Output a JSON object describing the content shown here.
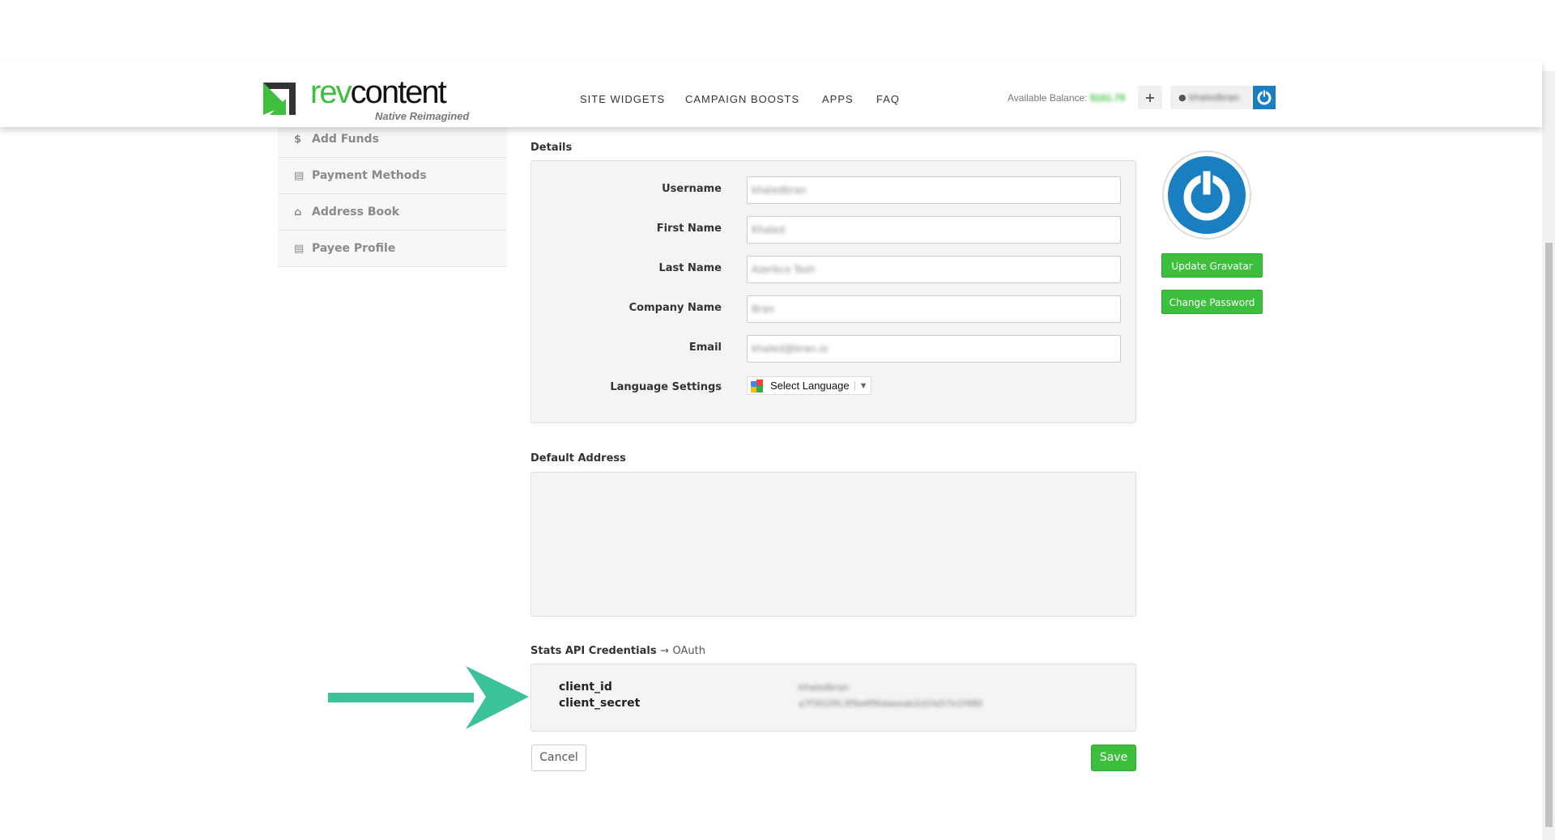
{
  "header": {
    "logo_text_a": "rev",
    "logo_text_b": "content",
    "logo_tagline": "Native Reimagined",
    "nav": [
      "SITE WIDGETS",
      "CAMPAIGN BOOSTS",
      "APPS",
      "FAQ"
    ],
    "balance_label": "Available Balance:",
    "balance_value": "$161.79",
    "add_funds_symbol": "+",
    "username": "khaledbran"
  },
  "sidebar": {
    "items": [
      {
        "icon": "dollar-icon",
        "label": "Add Funds"
      },
      {
        "icon": "credit-card-icon",
        "label": "Payment Methods"
      },
      {
        "icon": "home-icon",
        "label": "Address Book"
      },
      {
        "icon": "document-icon",
        "label": "Payee Profile"
      }
    ]
  },
  "details": {
    "title": "Details",
    "fields": [
      {
        "label": "Username",
        "value": "khaledbran"
      },
      {
        "label": "First Name",
        "value": "Khaled"
      },
      {
        "label": "Last Name",
        "value": "Azerbco Tosh"
      },
      {
        "label": "Company Name",
        "value": "Bran"
      },
      {
        "label": "Email",
        "value": "khaled@bran.io"
      }
    ],
    "language_label": "Language Settings",
    "language_select": "Select Language"
  },
  "profile": {
    "update_gravatar": "Update Gravatar",
    "change_password": "Change Password"
  },
  "address": {
    "title": "Default Address"
  },
  "credentials": {
    "title": "Stats API Credentials",
    "arrow": "→",
    "subtitle": "OAuth",
    "client_id_label": "client_id",
    "client_id_value": "khaledbran",
    "client_secret_label": "client_secret",
    "client_secret_value": "a7f3020fc3f9a4ff6daeeab2d1fa57e1f480"
  },
  "actions": {
    "cancel": "Cancel",
    "save": "Save"
  },
  "colors": {
    "accent_green": "#3cbf3c",
    "brand_blue": "#1a7fc1",
    "arrow_teal": "#3cc29a"
  }
}
